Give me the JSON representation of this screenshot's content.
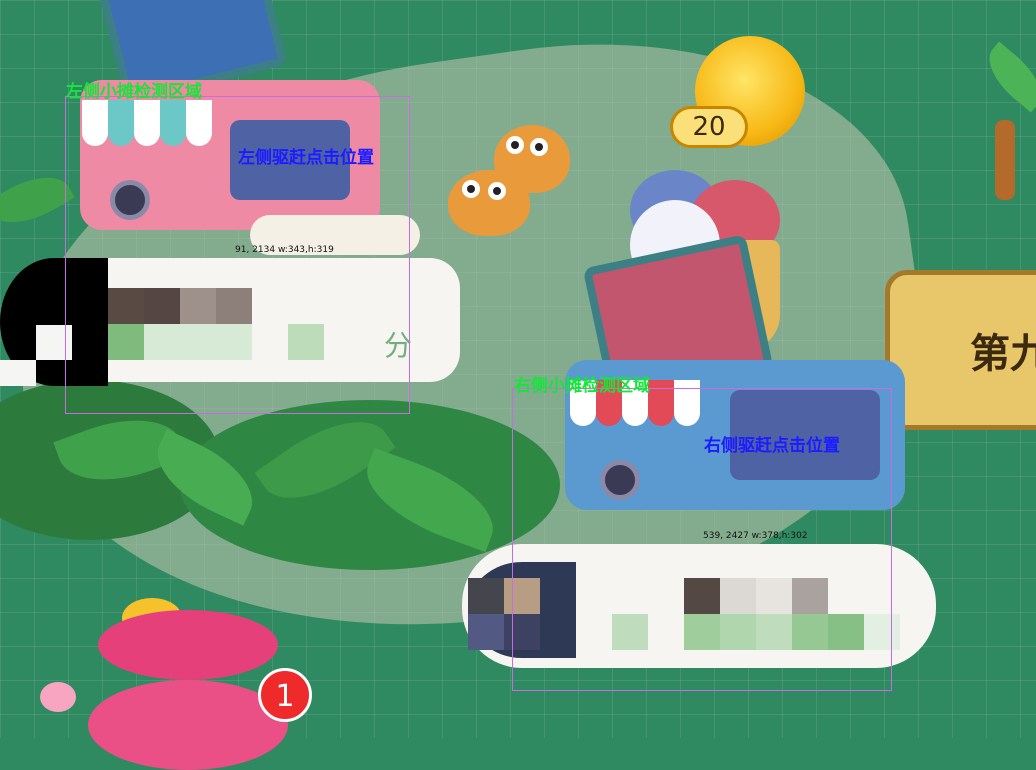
{
  "overlays": {
    "left_stall": {
      "detect_label": "左侧小摊检测区域",
      "click_label": "左侧驱赶点击位置",
      "coords": "91, 2134 w:343,h:319"
    },
    "right_stall": {
      "detect_label": "右侧小摊检测区域",
      "click_label": "右侧驱赶点击位置",
      "coords": "539, 2427 w:378,h:302"
    }
  },
  "left_bubble": {
    "score_suffix": "分"
  },
  "coin": {
    "amount": "20"
  },
  "sign": {
    "text": "第九"
  },
  "bag": {
    "badge_count": "1"
  },
  "colors": {
    "detect_label": "#16e53a",
    "click_label": "#1c1cff",
    "detect_box": "#c86ce4"
  }
}
